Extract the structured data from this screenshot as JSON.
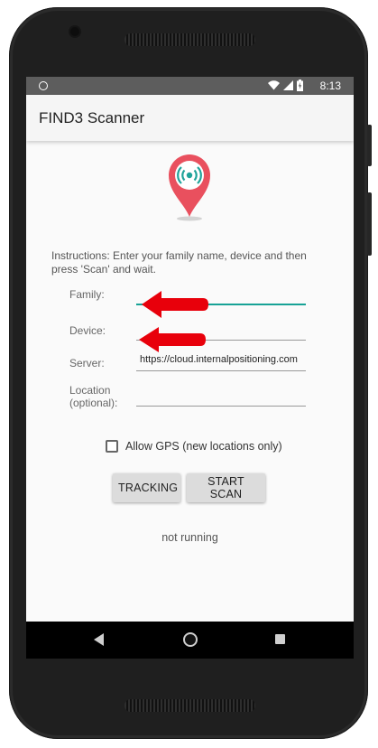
{
  "status_bar": {
    "time": "8:13",
    "icons": [
      "notification-dot-icon",
      "wifi-icon",
      "cellular-signal-icon",
      "battery-charging-icon"
    ]
  },
  "app_bar": {
    "title": "FIND3 Scanner"
  },
  "logo": {
    "icon": "location-pin-wireless-icon",
    "colors": {
      "pin": "#e9505e",
      "waves": "#1fa39a",
      "shadow": "#d0d0d0"
    }
  },
  "instructions": "Instructions: Enter your family name, device and then press 'Scan' and wait.",
  "form": {
    "family": {
      "label": "Family:",
      "value": ""
    },
    "device": {
      "label": "Device:",
      "value": ""
    },
    "server": {
      "label": "Server:",
      "value": "https://cloud.internalpositioning.com"
    },
    "location": {
      "label_line1": "Location",
      "label_line2": "(optional):",
      "value": ""
    }
  },
  "allow_gps": {
    "label": "Allow GPS (new locations only)",
    "checked": false
  },
  "buttons": {
    "tracking": "TRACKING",
    "start_scan": "START SCAN"
  },
  "status_text": "not running",
  "annotation": {
    "arrow_color": "#e8000b"
  },
  "colors": {
    "accent": "#17a296",
    "status_bar": "#5d5d5d",
    "app_bar": "#f5f5f5"
  }
}
